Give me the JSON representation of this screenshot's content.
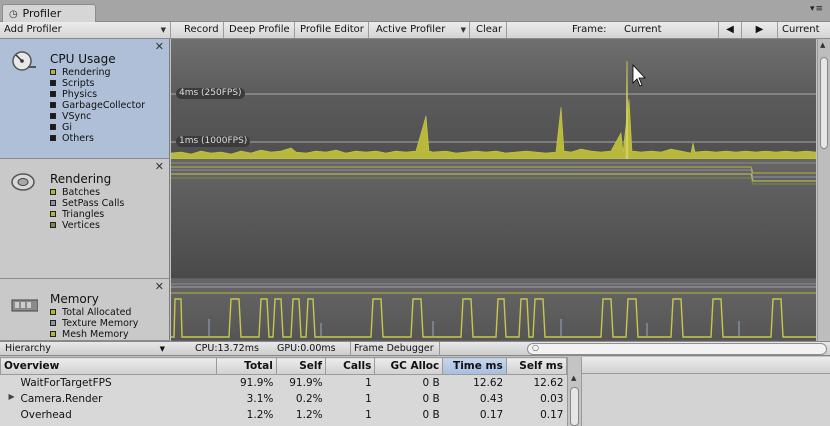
{
  "window": {
    "tab_title": "Profiler",
    "tab_icon": "profiler-icon"
  },
  "toolbar": {
    "add_profiler": "Add Profiler",
    "record": "Record",
    "deep_profile": "Deep Profile",
    "profile_editor": "Profile Editor",
    "active_profiler": "Active Profiler",
    "clear": "Clear",
    "frame_label": "Frame:",
    "frame_value": "Current",
    "current_button": "Current"
  },
  "areas": {
    "cpu": {
      "title": "CPU Usage",
      "legend": [
        {
          "label": "Rendering",
          "color": "#b5b53a"
        },
        {
          "label": "Scripts",
          "color": "#1a1a1a"
        },
        {
          "label": "Physics",
          "color": "#1a1a1a"
        },
        {
          "label": "GarbageCollector",
          "color": "#1a1a1a"
        },
        {
          "label": "VSync",
          "color": "#1a1a1a"
        },
        {
          "label": "Gi",
          "color": "#1a1a1a"
        },
        {
          "label": "Others",
          "color": "#1a1a1a"
        }
      ],
      "label_top": "4ms (250FPS)",
      "label_bottom": "1ms (1000FPS)"
    },
    "rendering": {
      "title": "Rendering",
      "legend": [
        {
          "label": "Batches",
          "color": "#b5b53a"
        },
        {
          "label": "SetPass Calls",
          "color": "#8a96a8"
        },
        {
          "label": "Triangles",
          "color": "#b5b53a"
        },
        {
          "label": "Vertices",
          "color": "#7a8a4a"
        }
      ]
    },
    "memory": {
      "title": "Memory",
      "legend": [
        {
          "label": "Total Allocated",
          "color": "#b5b53a"
        },
        {
          "label": "Texture Memory",
          "color": "#8a96a8"
        },
        {
          "label": "Mesh Memory",
          "color": "#b5b53a"
        }
      ]
    }
  },
  "detail": {
    "view_mode": "Hierarchy",
    "cpu_time": "CPU:13.72ms",
    "gpu_time": "GPU:0.00ms",
    "frame_debugger": "Frame Debugger"
  },
  "table": {
    "columns": [
      "Overview",
      "Total",
      "Self",
      "Calls",
      "GC Alloc",
      "Time ms",
      "Self ms"
    ],
    "rows": [
      {
        "name": "WaitForTargetFPS",
        "total": "91.9%",
        "self": "91.9%",
        "calls": "1",
        "gc": "0 B",
        "time": "12.62",
        "selfms": "12.62",
        "expandable": false
      },
      {
        "name": "Camera.Render",
        "total": "3.1%",
        "self": "0.2%",
        "calls": "1",
        "gc": "0 B",
        "time": "0.43",
        "selfms": "0.03",
        "expandable": true
      },
      {
        "name": "Overhead",
        "total": "1.2%",
        "self": "1.2%",
        "calls": "1",
        "gc": "0 B",
        "time": "0.17",
        "selfms": "0.17",
        "expandable": false
      }
    ]
  }
}
